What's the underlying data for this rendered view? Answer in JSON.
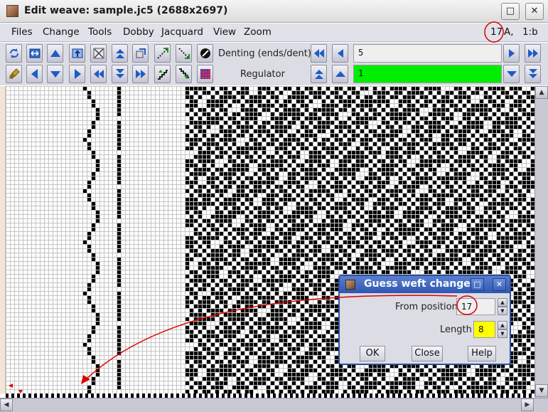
{
  "window": {
    "title": "Edit weave: sample.jc5 (2688x2697)",
    "maximize_glyph": "□",
    "close_glyph": "✕"
  },
  "menu": {
    "items": [
      "Files",
      "Change",
      "Tools",
      "Dobby",
      "Jacquard",
      "View",
      "Zoom"
    ]
  },
  "status": {
    "position": "17",
    "position_suffix": "A,",
    "scale": "1:b"
  },
  "toolbar": {
    "denting_label": "Denting (ends/dent)",
    "denting_value": "5",
    "regulator_label": "Regulator",
    "regulator_value": "1",
    "regulator_color": "#00ee00"
  },
  "dialog": {
    "title": "Guess weft change",
    "from_position_label": "From position",
    "from_position_value": "17",
    "length_label": "Length",
    "length_value": "8",
    "length_color": "#ffff00",
    "ok_label": "OK",
    "close_label": "Close",
    "help_label": "Help",
    "maximize_glyph": "□",
    "close_glyph": "✕"
  },
  "annotation": {
    "color": "#dd0000"
  }
}
